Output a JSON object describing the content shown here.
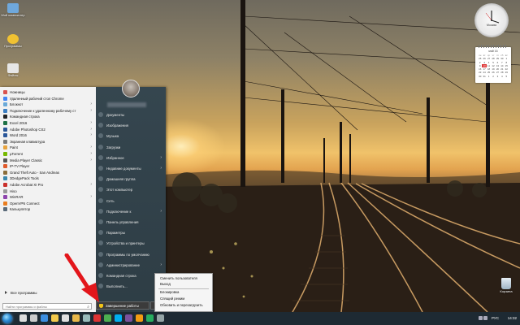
{
  "desktop_icons": [
    {
      "label": "Мой компьютер",
      "color": "#6fa8dc"
    },
    {
      "label": "Программы",
      "color": "#f1c232"
    },
    {
      "label": "Файлы",
      "color": "#e6e6e6"
    }
  ],
  "start_menu": {
    "programs": [
      {
        "label": "Ножницы",
        "icon_color": "#d9534f",
        "has_submenu": false
      },
      {
        "label": "Удаленный рабочий стол Chrome",
        "icon_color": "#4285f4",
        "has_submenu": false
      },
      {
        "label": "Блокнот",
        "icon_color": "#6aa9d8",
        "has_submenu": true
      },
      {
        "label": "Подключение к удаленному рабочему ст",
        "icon_color": "#3d7fc1",
        "has_submenu": true
      },
      {
        "label": "Командная строка",
        "icon_color": "#222222",
        "has_submenu": false
      },
      {
        "label": "Excel 2016",
        "icon_color": "#1e7145",
        "has_submenu": true
      },
      {
        "label": "Adobe Photoshop CS2",
        "icon_color": "#2b5797",
        "has_submenu": true
      },
      {
        "label": "Word 2016",
        "icon_color": "#2b579a",
        "has_submenu": true
      },
      {
        "label": "Экранная клавиатура",
        "icon_color": "#7a7a7a",
        "has_submenu": false
      },
      {
        "label": "Paint",
        "icon_color": "#e8a33d",
        "has_submenu": true
      },
      {
        "label": "µTorrent",
        "icon_color": "#76b900",
        "has_submenu": true
      },
      {
        "label": "Media Player Classic",
        "icon_color": "#555555",
        "has_submenu": true
      },
      {
        "label": "IP-TV Player",
        "icon_color": "#e05a2b",
        "has_submenu": false
      },
      {
        "label": "Grand Theft Auto - San Andreas",
        "icon_color": "#8a6d3b",
        "has_submenu": false
      },
      {
        "label": "3DedgePack Tools",
        "icon_color": "#3a87ad",
        "has_submenu": false
      },
      {
        "label": "Adobe Acrobat XI Pro",
        "icon_color": "#c9302c",
        "has_submenu": true
      },
      {
        "label": "Hiso",
        "icon_color": "#999999",
        "has_submenu": false
      },
      {
        "label": "WinRAR",
        "icon_color": "#8e44ad",
        "has_submenu": true
      },
      {
        "label": "OpenVPN Connect",
        "icon_color": "#ea7e20",
        "has_submenu": false
      },
      {
        "label": "Калькулятор",
        "icon_color": "#5b6b7a",
        "has_submenu": false
      }
    ],
    "all_programs_label": "Все программы",
    "search_placeholder": "Найти программы и файлы",
    "places": [
      {
        "label": "Документы",
        "has_submenu": false
      },
      {
        "label": "Изображения",
        "has_submenu": false
      },
      {
        "label": "Музыка",
        "has_submenu": false
      },
      {
        "label": "Загрузки",
        "has_submenu": false
      },
      {
        "label": "Избранное",
        "has_submenu": true
      },
      {
        "label": "Недавние документы",
        "has_submenu": true
      },
      {
        "label": "Домашняя группа",
        "has_submenu": false
      },
      {
        "label": "Этот компьютер",
        "has_submenu": false
      },
      {
        "label": "Сеть",
        "has_submenu": false
      },
      {
        "label": "Подключение к",
        "has_submenu": true
      },
      {
        "label": "Панель управления",
        "has_submenu": false
      },
      {
        "label": "Параметры",
        "has_submenu": false
      },
      {
        "label": "Устройства и принтеры",
        "has_submenu": false
      },
      {
        "label": "Программы по умолчанию",
        "has_submenu": false
      },
      {
        "label": "Администрирование",
        "has_submenu": true
      },
      {
        "label": "Командная строка",
        "has_submenu": false
      },
      {
        "label": "Выполнить...",
        "has_submenu": false
      }
    ],
    "shutdown_label": "Завершение работы",
    "power_submenu": {
      "group1": [
        "Сменить пользователя",
        "Выход"
      ],
      "group2": [
        "Блокировка",
        "Спящий режим",
        "Обновить и перезагрузить"
      ]
    }
  },
  "gadgets": {
    "clock_label": "Москва",
    "calendar": {
      "month": "май 16",
      "weekdays": [
        "пн",
        "вт",
        "ср",
        "чт",
        "пт",
        "сб",
        "вс"
      ],
      "days": [
        "25",
        "26",
        "27",
        "28",
        "29",
        "30",
        "1",
        "2",
        "3",
        "4",
        "5",
        "6",
        "7",
        "8",
        "9",
        "10",
        "11",
        "12",
        "13",
        "14",
        "15",
        "16",
        "17",
        "18",
        "19",
        "20",
        "21",
        "22",
        "23",
        "24",
        "25",
        "26",
        "27",
        "28",
        "29",
        "30",
        "31",
        "1",
        "2",
        "3",
        "4",
        "5"
      ],
      "today_index": 15
    }
  },
  "recycle_bin": {
    "label": "Корзина"
  },
  "taskbar": {
    "icons": [
      {
        "name": "search-taskbar-icon",
        "color": "#dddddd"
      },
      {
        "name": "task-view-icon",
        "color": "#cccccc"
      },
      {
        "name": "edge-icon",
        "color": "#3c8ee0"
      },
      {
        "name": "explorer-icon",
        "color": "#f2c94c"
      },
      {
        "name": "store-icon",
        "color": "#e0e0e0"
      },
      {
        "name": "folder-icon",
        "color": "#e8b84a"
      },
      {
        "name": "mail-icon",
        "color": "#9bb"
      },
      {
        "name": "opera-icon",
        "color": "#d33"
      },
      {
        "name": "chrome-icon",
        "color": "#4caf50"
      },
      {
        "name": "skype-icon",
        "color": "#00aff0"
      },
      {
        "name": "viber-icon",
        "color": "#7b519d"
      },
      {
        "name": "media-icon",
        "color": "#f39c12"
      },
      {
        "name": "app-icon",
        "color": "#27ae60"
      },
      {
        "name": "settings-taskbar-icon",
        "color": "#95a5a6"
      }
    ],
    "language": "РУС",
    "time": "14:32"
  }
}
